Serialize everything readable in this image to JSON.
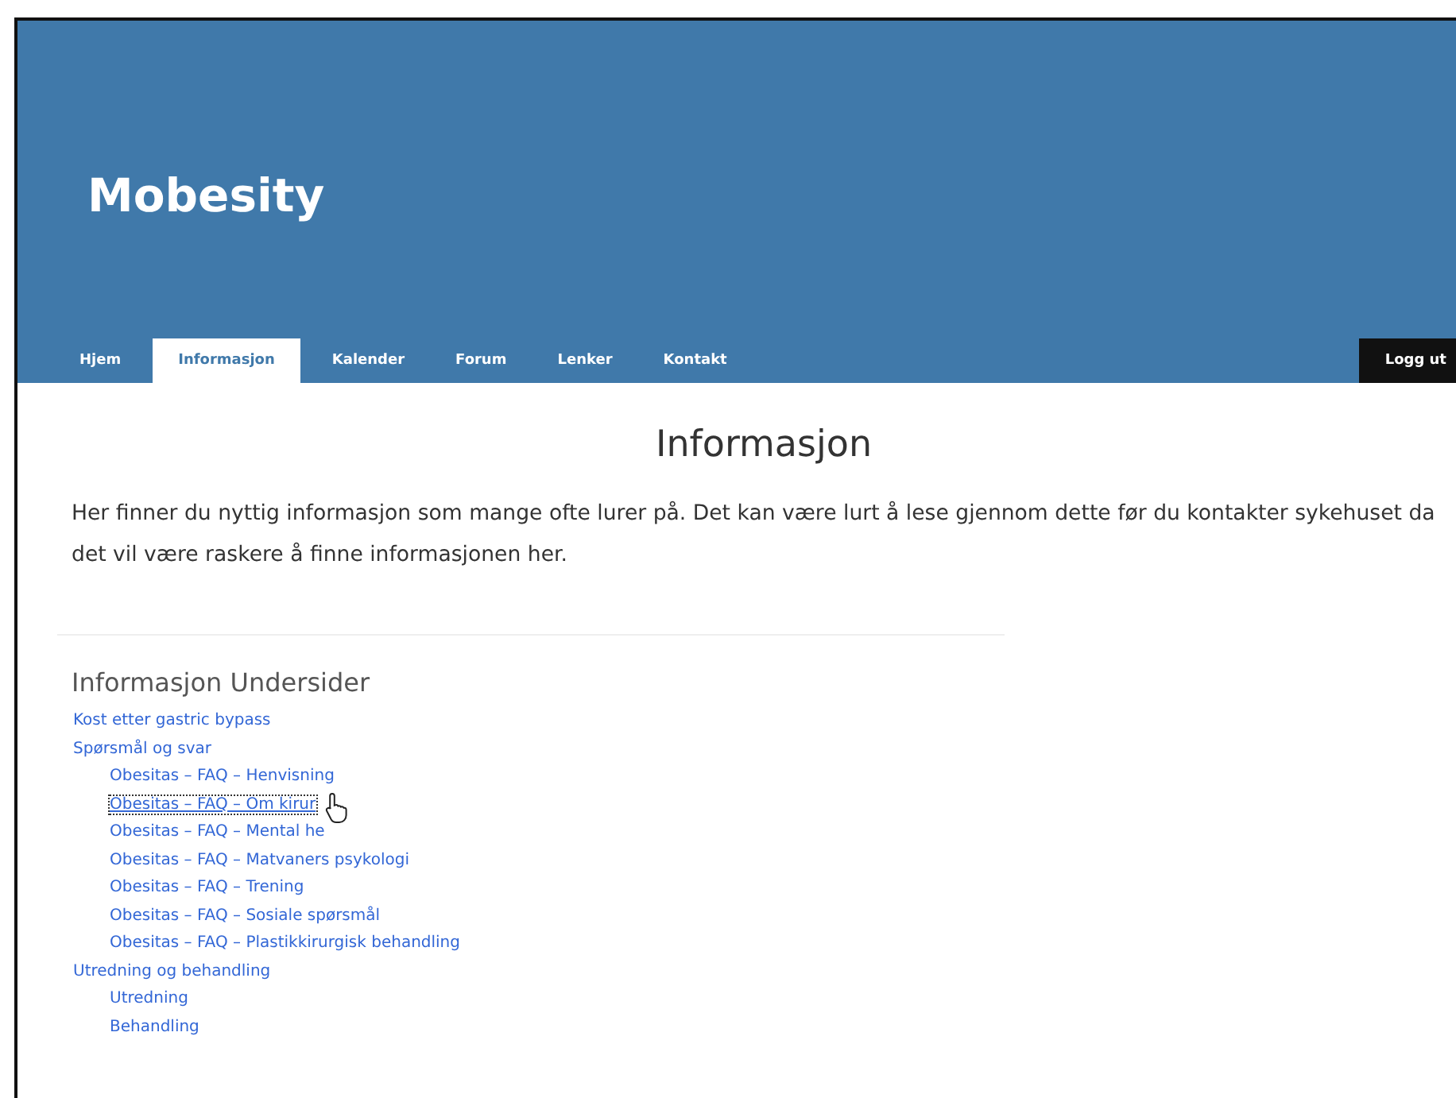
{
  "site_title": "Mobesity",
  "nav": [
    {
      "label": "Hjem",
      "selected": false
    },
    {
      "label": "Informasjon",
      "selected": true
    },
    {
      "label": "Kalender",
      "selected": false
    },
    {
      "label": "Forum",
      "selected": false
    },
    {
      "label": "Lenker",
      "selected": false
    },
    {
      "label": "Kontakt",
      "selected": false
    }
  ],
  "logout": "Logg ut",
  "heading": "Informasjon",
  "intro": "Her finner du nyttig informasjon som mange ofte lurer på. Det kan være lurt å lese gjennom dette før du kontakter sykehuset da det vil være raskere å finne informasjonen her.",
  "subpages": {
    "title": "Informasjon Undersider",
    "items": [
      {
        "label": "Kost etter gastric bypass",
        "focused": false
      },
      {
        "label": "Spørsmål og svar",
        "focused": false,
        "children": [
          {
            "label": "Obesitas – FAQ – Henvisning",
            "focused": false
          },
          {
            "label": "Obesitas – FAQ – Om kirur",
            "focused": true
          },
          {
            "label": "Obesitas – FAQ – Mental he",
            "focused": false
          },
          {
            "label": "Obesitas – FAQ – Matvaners psykologi",
            "focused": false
          },
          {
            "label": "Obesitas – FAQ – Trening",
            "focused": false
          },
          {
            "label": "Obesitas – FAQ – Sosiale spørsmål",
            "focused": false
          },
          {
            "label": "Obesitas – FAQ – Plastikkirurgisk behandling",
            "focused": false
          }
        ]
      },
      {
        "label": "Utredning og behandling",
        "focused": false,
        "children": [
          {
            "label": "Utredning",
            "focused": false
          },
          {
            "label": "Behandling",
            "focused": false
          }
        ]
      }
    ]
  }
}
